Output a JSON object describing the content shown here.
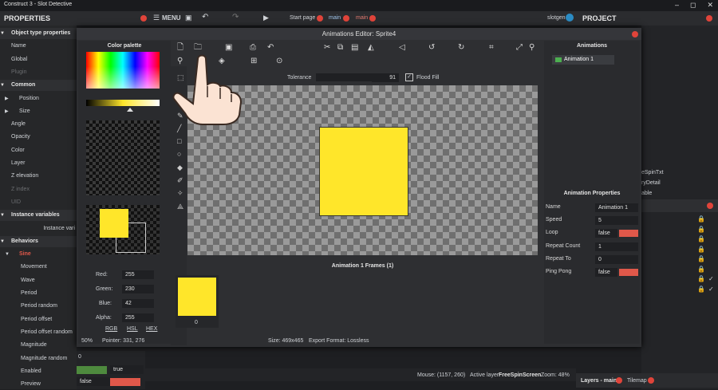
{
  "app": {
    "title": "Construct 3 - Slot Detective",
    "win_controls": [
      "–",
      "◻",
      "✕"
    ]
  },
  "topbar": {
    "properties_label": "PROPERTIES",
    "menu_label": "MENU",
    "tabs": [
      "Start page",
      "main",
      "main"
    ],
    "user": "slotgen",
    "project_label": "PROJECT"
  },
  "left_panel": {
    "rows": [
      {
        "text": "Object type properties",
        "kind": "section"
      },
      {
        "text": "Name",
        "kind": "item"
      },
      {
        "text": "Global",
        "kind": "item"
      },
      {
        "text": "Plugin",
        "kind": "dim"
      },
      {
        "text": "Common",
        "kind": "section"
      },
      {
        "text": "Position",
        "kind": "sub"
      },
      {
        "text": "Size",
        "kind": "sub"
      },
      {
        "text": "Angle",
        "kind": "item"
      },
      {
        "text": "Opacity",
        "kind": "item"
      },
      {
        "text": "Color",
        "kind": "item"
      },
      {
        "text": "Layer",
        "kind": "item"
      },
      {
        "text": "Z elevation",
        "kind": "item"
      },
      {
        "text": "Z index",
        "kind": "dim"
      },
      {
        "text": "UID",
        "kind": "dim"
      },
      {
        "text": "Instance variables",
        "kind": "section"
      },
      {
        "text": "Instance vari",
        "kind": "right"
      },
      {
        "text": "Behaviors",
        "kind": "section"
      },
      {
        "text": "Sine",
        "kind": "red"
      },
      {
        "text": "Movement",
        "kind": "deep"
      },
      {
        "text": "Wave",
        "kind": "deep"
      },
      {
        "text": "Period",
        "kind": "deep"
      },
      {
        "text": "Period random",
        "kind": "deep"
      },
      {
        "text": "Period offset",
        "kind": "deep"
      },
      {
        "text": "Period offset random",
        "kind": "deep"
      },
      {
        "text": "Magnitude",
        "kind": "deep"
      },
      {
        "text": "Magnitude random",
        "kind": "deep"
      },
      {
        "text": "Enabled",
        "kind": "deep"
      },
      {
        "text": "Preview",
        "kind": "deep"
      }
    ],
    "under_values": {
      "zero": "0",
      "enabled": "true",
      "preview": "false"
    }
  },
  "dialog": {
    "title": "Animations Editor: Sprite4",
    "color_palette": {
      "title": "Color palette",
      "red_label": "Red:",
      "red": "255",
      "green_label": "Green:",
      "green": "230",
      "blue_label": "Blue:",
      "blue": "42",
      "alpha_label": "Alpha:",
      "alpha": "255",
      "modes": [
        "RGB",
        "HSL",
        "HEX"
      ],
      "primary_color": "#ffe62a"
    },
    "toolbar": {
      "tolerance_label": "Tolerance",
      "tolerance_value": "91",
      "flood_fill_label": "Flood Fill"
    },
    "animations": {
      "title": "Animations",
      "items": [
        "Animation 1"
      ]
    },
    "anim_props": {
      "title": "Animation Properties",
      "rows": [
        {
          "label": "Name",
          "value": "Animation 1"
        },
        {
          "label": "Speed",
          "value": "5"
        },
        {
          "label": "Loop",
          "value": "false"
        },
        {
          "label": "Repeat Count",
          "value": "1"
        },
        {
          "label": "Repeat To",
          "value": "0"
        },
        {
          "label": "Ping Pong",
          "value": "false"
        }
      ]
    },
    "frames": {
      "title": "Animation 1 Frames (1)",
      "items": [
        "0"
      ]
    },
    "status": {
      "zoom": "50%",
      "pointer": "Pointer: 331, 276",
      "size": "Size: 469x465",
      "export": "Export Format: Lossless"
    }
  },
  "right_panel": {
    "fragments": [
      "eSpinTxt",
      "ryDetail",
      "able"
    ]
  },
  "statusbar": {
    "mouse": "Mouse: (1157, 260)",
    "active_layer_label": "Active layer:",
    "active_layer": "FreeSpinScreen",
    "zoom": "Zoom: 48%"
  },
  "bottom_tabs": [
    "Layers - main",
    "Tilemap"
  ]
}
